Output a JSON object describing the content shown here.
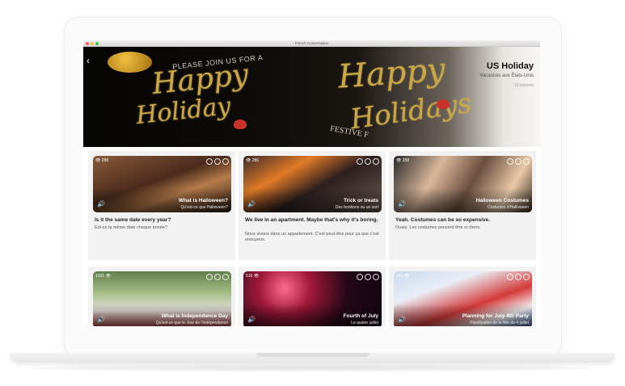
{
  "window": {
    "title": "French Conversation"
  },
  "hero": {
    "back_icon": "chevron-left-icon",
    "art_line1": "PLEASE JOIN US FOR A",
    "art_line2": "Happy",
    "art_line3": "Holiday",
    "art_line4": "Happy",
    "art_line5": "Holidays",
    "art_line6": "FESTIVE F",
    "title": "US Holiday",
    "subtitle": "Vacances aux États-Unis",
    "lesson_count": "15 lessons"
  },
  "cards": [
    {
      "views": "288",
      "title": "What is Halloween?",
      "subtitle": "Qu'est-ce que Halloween?",
      "english": "Is it the same date every year?",
      "french": "Est-ce la même date chaque année?"
    },
    {
      "views": "286",
      "title": "Trick or treats",
      "subtitle": "Des bonbons ou un sort",
      "english": "We live in an apartment. Maybe that's why it's boring.",
      "french": "Nous vivons dans un appartement. C'est peut-être pour ça que c'est ennuyeux."
    },
    {
      "views": "258",
      "title": "Halloween Costumes",
      "subtitle": "Costumes d'Halloween",
      "english": "Yeah. Costumes can be so expensive.",
      "french": "Ouais. Les costumes peuvent être si chers."
    },
    {
      "views": "1031",
      "title": "What is Independence Day",
      "subtitle": "Qu'est-ce que le Jour de l'indépendance",
      "english": "",
      "french": ""
    },
    {
      "views": "516",
      "title": "Fourth of July",
      "subtitle": "Le quatre juillet",
      "english": "",
      "french": ""
    },
    {
      "views": "169",
      "title": "Planning for July 4th Party",
      "subtitle": "Planification de la fête du 4 juillet",
      "english": "",
      "french": ""
    }
  ]
}
